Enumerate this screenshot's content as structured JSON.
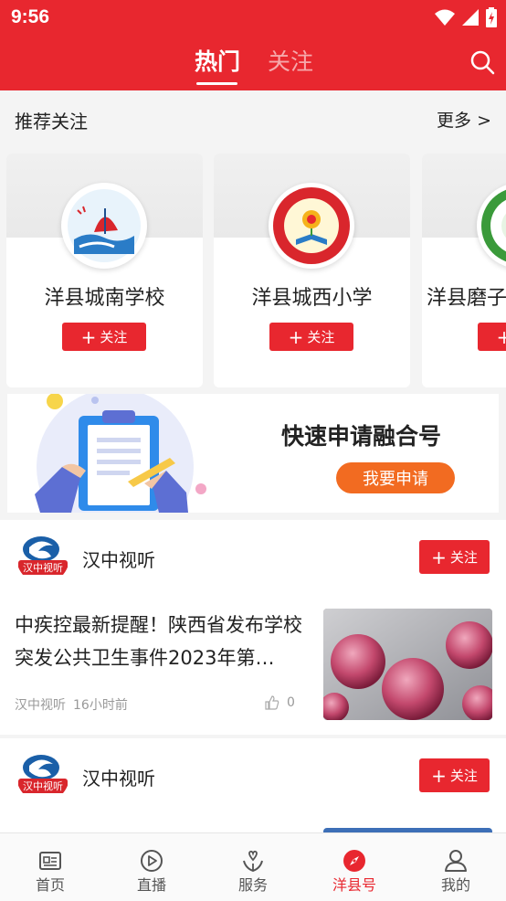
{
  "status": {
    "time": "9:56"
  },
  "header": {
    "tabs": [
      {
        "label": "热门",
        "active": true
      },
      {
        "label": "关注",
        "active": false
      }
    ],
    "accent": "#e8272f"
  },
  "recommend": {
    "title": "推荐关注",
    "more": "更多 >",
    "cards": [
      {
        "name": "洋县城南学校",
        "button": "关注",
        "logo": "school-emblem-icon"
      },
      {
        "name": "洋县城西小学",
        "button": "关注",
        "logo": "school-emblem-icon"
      },
      {
        "name": "洋县磨子",
        "button": "关注",
        "logo": "school-emblem-icon"
      }
    ]
  },
  "banner": {
    "title": "快速申请融合号",
    "button": "我要申请"
  },
  "feed": [
    {
      "account": "汉中视听",
      "avatar_text": "汉中视听",
      "follow": "关注",
      "title": "中疾控最新提醒！陕西省发布学校突发公共卫生事件2023年第…",
      "source": "汉中视听",
      "time": "16小时前",
      "likes": "0"
    },
    {
      "account": "汉中视听",
      "avatar_text": "汉中视听",
      "follow": "关注"
    }
  ],
  "bottom_nav": [
    {
      "label": "首页",
      "icon": "home-news-icon",
      "active": false
    },
    {
      "label": "直播",
      "icon": "play-circle-icon",
      "active": false
    },
    {
      "label": "服务",
      "icon": "heart-hands-icon",
      "active": false
    },
    {
      "label": "洋县号",
      "icon": "compass-icon",
      "active": true
    },
    {
      "label": "我的",
      "icon": "user-icon",
      "active": false
    }
  ]
}
